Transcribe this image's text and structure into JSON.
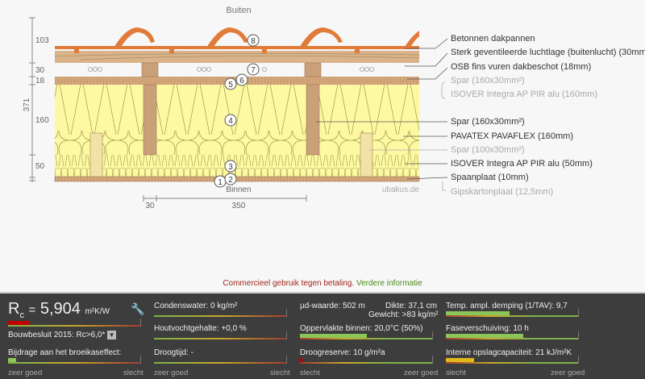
{
  "diagram": {
    "outside_label": "Buiten",
    "inside_label": "Binnen",
    "watermark": "ubakus.de",
    "dims_vertical": [
      "103",
      "30",
      "18",
      "160",
      "50"
    ],
    "total": "371",
    "dims_horizontal": [
      "30",
      "350"
    ],
    "markers": [
      "1",
      "2",
      "3",
      "4",
      "5",
      "6",
      "7",
      "8"
    ],
    "colors": {
      "tile": "#e07b39",
      "wood": "#d9b48a",
      "insulation": "#fdf7a0"
    }
  },
  "layers": [
    {
      "label": "Betonnen dakpannen",
      "muted": false
    },
    {
      "label": "Sterk geventileerde luchtlage (buitenlucht) (30mm)",
      "muted": false
    },
    {
      "label": "OSB fins vuren dakbeschot (18mm)",
      "muted": false
    },
    {
      "label": "Spar (160x30mm²)",
      "muted": true
    },
    {
      "label": "ISOVER Integra AP PIR alu (160mm)",
      "muted": true
    },
    {
      "label": "Spar (160x30mm²)",
      "muted": false
    },
    {
      "label": "PAVATEX PAVAFLEX (160mm)",
      "muted": false
    },
    {
      "label": "Spar (100x30mm²)",
      "muted": true
    },
    {
      "label": "ISOVER Integra AP PIR alu (50mm)",
      "muted": false
    },
    {
      "label": "Spaanplaat (10mm)",
      "muted": false
    },
    {
      "label": "Gipskartonplaat (12,5mm)",
      "muted": true
    }
  ],
  "commercial": {
    "text": "Commercieel gebruik tegen betaling.",
    "link": "Verdere informatie"
  },
  "panel": {
    "rc_symbol": "R",
    "rc_sub": "c",
    "rc_eq": "=",
    "rc_value": "5,904",
    "rc_unit": "m²K/W",
    "norm": "Bouwbesluit 2015: Rc>6,0*",
    "greenhouse": "Bijdrage aan het broeikaseffect:",
    "condensate": "Condenswater: 0 kg/m²",
    "wood_moisture": "Houtvochtgehalte: +0,0 %",
    "drying_time": "Droogtijd: -",
    "sd": "µd-waarde: 502 m",
    "thickness": "Dikte: 37,1 cm",
    "weight": "Gewicht: >83 kg/m²",
    "surface": "Oppervlakte binnen: 20,0°C (50%)",
    "drying_reserve": "Droogreserve: 10 g/m²a",
    "tav": "Temp. ampl. demping (1/TAV): 9,7",
    "phase": "Faseverschuiving: 10 h",
    "storage": "Interne opslagcapaciteit: 21 kJ/m²K",
    "good": "zeer goed",
    "bad": "slecht",
    "levels": {
      "rc": 0.16,
      "greenhouse": 0.06,
      "tav": 0.48,
      "phase": 0.58,
      "storage": 0.21,
      "surface": 0.5,
      "drying_reserve": 0.02
    },
    "colors": {
      "red": "#c00000",
      "green": "#8cc65a",
      "yellow": "#e0b81c"
    }
  }
}
